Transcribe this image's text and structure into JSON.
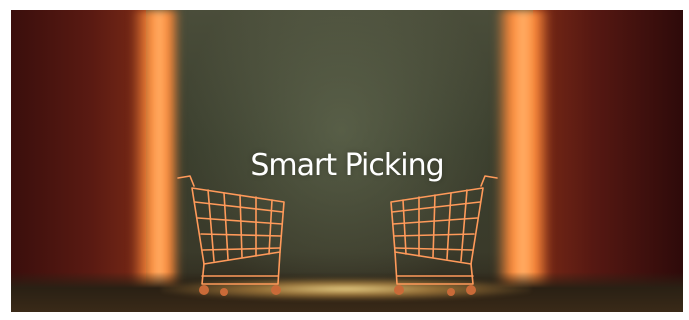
{
  "banner": {
    "title": "Smart Picking"
  },
  "colors": {
    "wall": "#5a1a12",
    "glow": "#ff8a3a",
    "center": "#4a4d3a",
    "cart_line": "#ff9a5a"
  },
  "icons": [
    "shopping-cart-icon",
    "shopping-cart-icon"
  ]
}
